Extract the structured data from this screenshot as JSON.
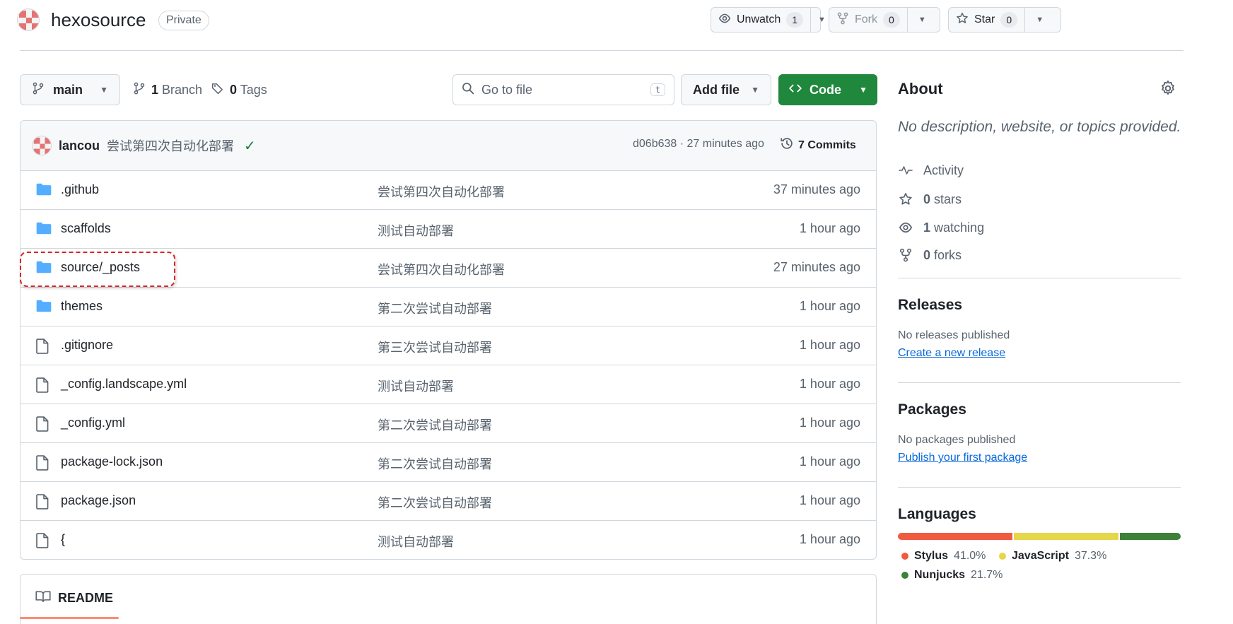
{
  "repo": {
    "name": "hexosource",
    "visibility": "Private"
  },
  "actions": {
    "watch": {
      "label": "Unwatch",
      "count": "1"
    },
    "fork": {
      "label": "Fork",
      "count": "0"
    },
    "star": {
      "label": "Star",
      "count": "0"
    }
  },
  "toolbar": {
    "branch": "main",
    "branches_count": "1",
    "branches_label": "Branch",
    "tags_count": "0",
    "tags_label": "Tags",
    "go_to_file_placeholder": "Go to file",
    "go_to_file_key": "t",
    "add_file_label": "Add file",
    "code_label": "Code"
  },
  "latest_commit": {
    "author": "lancou",
    "message": "尝试第四次自动化部署",
    "status": "✓",
    "meta": "d06b638 · 27 minutes ago",
    "commits_label": "7 Commits"
  },
  "files": [
    {
      "type": "dir",
      "name": ".github",
      "message": "尝试第四次自动化部署",
      "time": "37 minutes ago"
    },
    {
      "type": "dir",
      "name": "scaffolds",
      "message": "测试自动部署",
      "time": "1 hour ago"
    },
    {
      "type": "dir",
      "name": "source/_posts",
      "message": "尝试第四次自动化部署",
      "time": "27 minutes ago"
    },
    {
      "type": "dir",
      "name": "themes",
      "message": "第二次尝试自动部署",
      "time": "1 hour ago"
    },
    {
      "type": "file",
      "name": ".gitignore",
      "message": "第三次尝试自动部署",
      "time": "1 hour ago"
    },
    {
      "type": "file",
      "name": "_config.landscape.yml",
      "message": "测试自动部署",
      "time": "1 hour ago"
    },
    {
      "type": "file",
      "name": "_config.yml",
      "message": "第二次尝试自动部署",
      "time": "1 hour ago"
    },
    {
      "type": "file",
      "name": "package-lock.json",
      "message": "第二次尝试自动部署",
      "time": "1 hour ago"
    },
    {
      "type": "file",
      "name": "package.json",
      "message": "第二次尝试自动部署",
      "time": "1 hour ago"
    },
    {
      "type": "file",
      "name": "{",
      "message": "测试自动部署",
      "time": "1 hour ago"
    }
  ],
  "readme": {
    "label": "README"
  },
  "about": {
    "title": "About",
    "description": "No description, website, or topics provided.",
    "activity": "Activity",
    "stars_count": "0",
    "stars_label": "stars",
    "watching_count": "1",
    "watching_label": "watching",
    "forks_count": "0",
    "forks_label": "forks"
  },
  "releases": {
    "title": "Releases",
    "note": "No releases published",
    "link": "Create a new release"
  },
  "packages": {
    "title": "Packages",
    "note": "No packages published",
    "link": "Publish your first package"
  },
  "languages": {
    "title": "Languages",
    "items": [
      {
        "name": "Stylus",
        "percent": "41.0%",
        "value": 41.0,
        "color": "#f05b3f"
      },
      {
        "name": "JavaScript",
        "percent": "37.3%",
        "value": 37.3,
        "color": "#e6d64a"
      },
      {
        "name": "Nunjucks",
        "percent": "21.7%",
        "value": 21.7,
        "color": "#3d8137"
      }
    ]
  },
  "colors": {
    "accent_green": "#1f883d",
    "link_blue": "#0969da",
    "folder_blue": "#54aeff",
    "highlight_red": "#d92626"
  }
}
